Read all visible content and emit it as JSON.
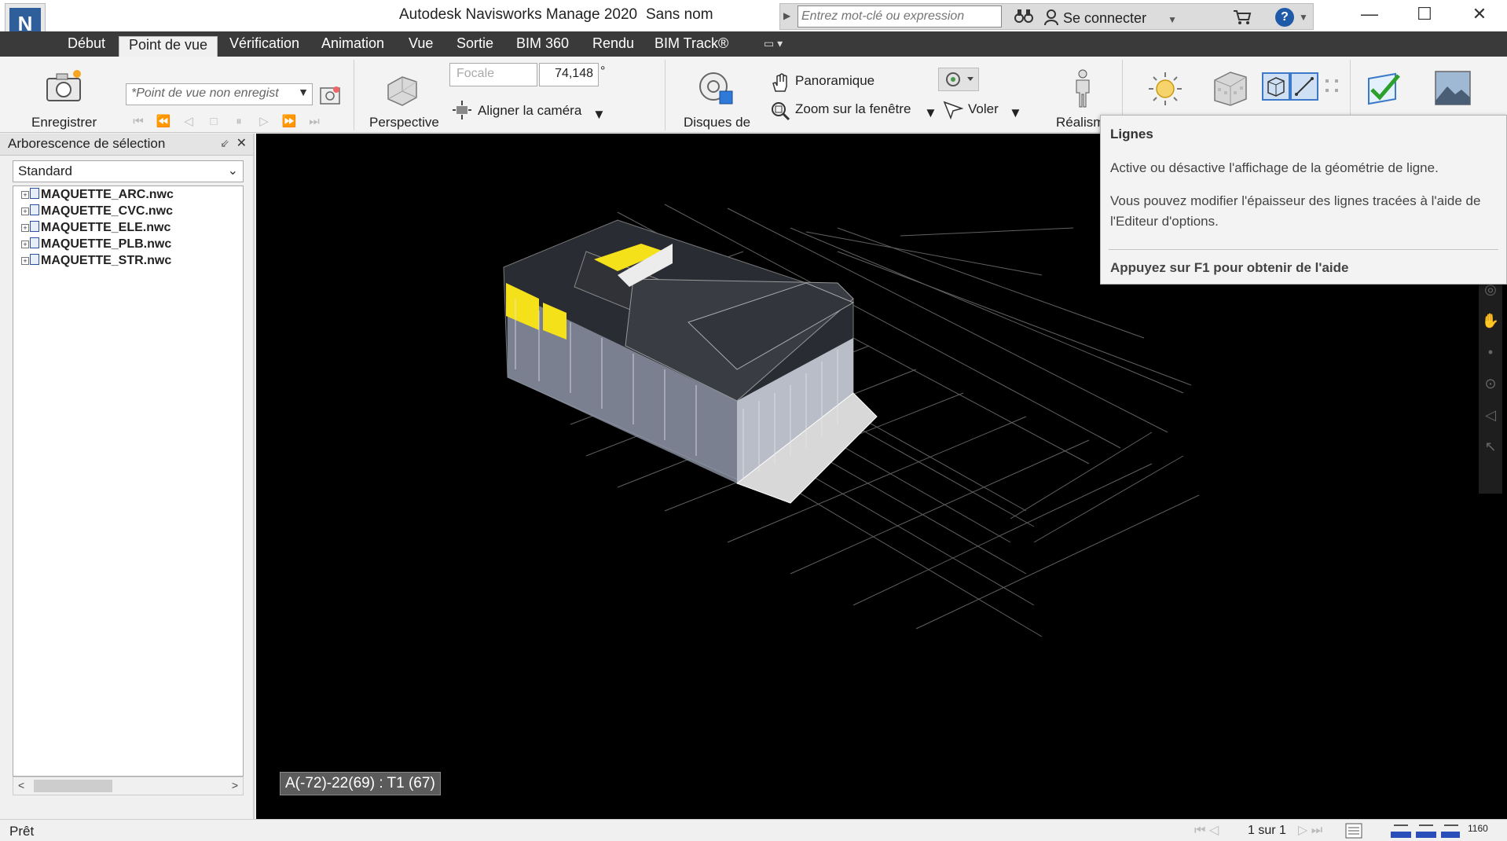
{
  "window": {
    "app_title": "Autodesk Navisworks Manage 2020",
    "doc_title": "Sans nom",
    "logo_letter": "N",
    "search_placeholder": "Entrez mot-clé ou expression",
    "signin_label": "Se connecter",
    "help_label": "?",
    "controls": [
      "—",
      "☐",
      "✕"
    ]
  },
  "tabs": [
    {
      "label": "Début"
    },
    {
      "label": "Point de vue",
      "active": true
    },
    {
      "label": "Vérification"
    },
    {
      "label": "Animation"
    },
    {
      "label": "Vue"
    },
    {
      "label": "Sortie"
    },
    {
      "label": "BIM 360"
    },
    {
      "label": "Rendu"
    },
    {
      "label": "BIM Track®"
    }
  ],
  "ribbon": {
    "save_label": "Enregistrer",
    "viewpoint_combo": "*Point de vue non enregist",
    "perspective_label": "Perspective",
    "focal_label": "Focale",
    "focal_value": "74,148",
    "focal_unit": "°",
    "align_camera_label": "Aligner la caméra",
    "disks_label": "Disques de",
    "pan_label": "Panoramique",
    "zoom_window_label": "Zoom sur la fenêtre",
    "fly_label": "Voler",
    "realism_label": "Réalism"
  },
  "left_panel": {
    "title": "Arborescence de sélection",
    "select_value": "Standard",
    "items": [
      "MAQUETTE_ARC.nwc",
      "MAQUETTE_CVC.nwc",
      "MAQUETTE_ELE.nwc",
      "MAQUETTE_PLB.nwc",
      "MAQUETTE_STR.nwc"
    ]
  },
  "viewport": {
    "grid_label": "A(-72)-22(69) : T1 (67)"
  },
  "tooltip": {
    "title": "Lignes",
    "line1": "Active ou désactive l'affichage de la géométrie de ligne.",
    "line2": "Vous pouvez modifier l'épaisseur des lignes tracées à l'aide de l'Editeur d'options.",
    "footer": "Appuyez sur F1 pour obtenir de l'aide"
  },
  "status": {
    "text": "Prêt",
    "page": "1 sur 1",
    "memory": "1160"
  },
  "colors": {
    "viewport_bg": "#000000",
    "tabs_bg": "#3a3a3a",
    "accent_blue": "#1e5aa8",
    "highlight_yellow": "#f5e11a"
  }
}
